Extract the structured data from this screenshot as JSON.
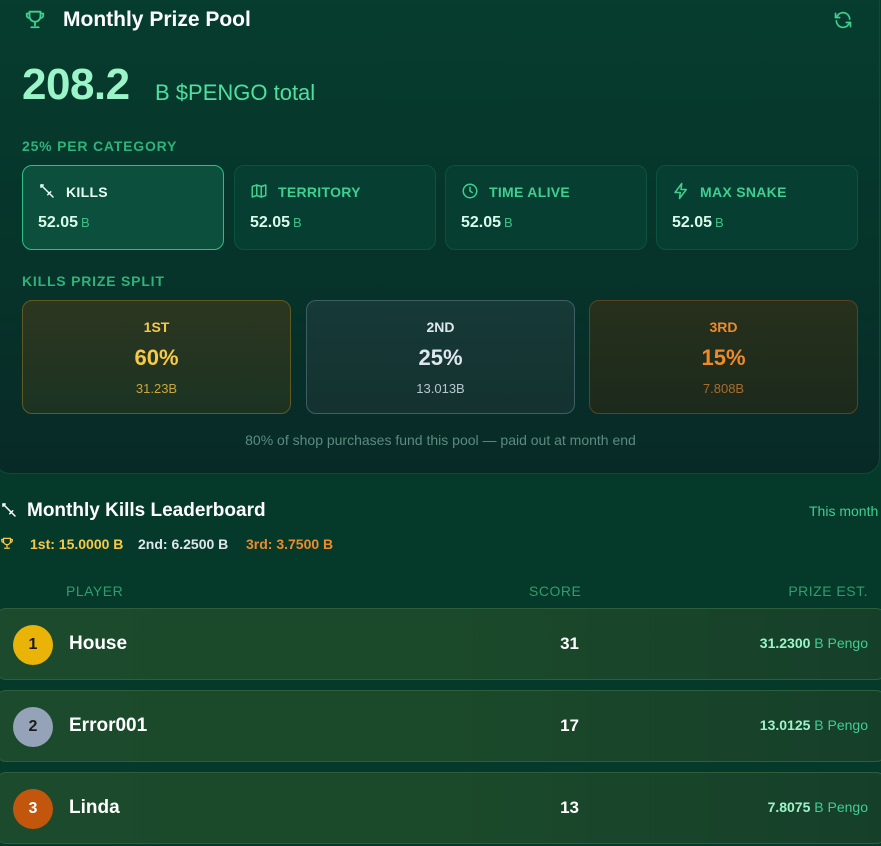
{
  "header": {
    "title": "Monthly Prize Pool",
    "icon": "trophy-icon",
    "refresh_icon": "refresh-icon"
  },
  "pool": {
    "amount": "208.2",
    "unit": "B $PENGO total"
  },
  "categories_label": "25% PER CATEGORY",
  "categories": [
    {
      "name": "KILLS",
      "icon": "sword-icon",
      "value": "52.05",
      "unit": "B",
      "active": true
    },
    {
      "name": "TERRITORY",
      "icon": "map-icon",
      "value": "52.05",
      "unit": "B",
      "active": false
    },
    {
      "name": "TIME ALIVE",
      "icon": "clock-icon",
      "value": "52.05",
      "unit": "B",
      "active": false
    },
    {
      "name": "MAX SNAKE",
      "icon": "lightning-icon",
      "value": "52.05",
      "unit": "B",
      "active": false
    }
  ],
  "split_label": "KILLS PRIZE SPLIT",
  "split": [
    {
      "rank": "1ST",
      "pct": "60%",
      "amount": "31.23B",
      "color": "#f7c948"
    },
    {
      "rank": "2ND",
      "pct": "25%",
      "amount": "13.013B",
      "color": "#dfe7ee"
    },
    {
      "rank": "3RD",
      "pct": "15%",
      "amount": "7.808B",
      "color": "#ef8a2a"
    }
  ],
  "footnote": "80% of shop purchases fund this pool — paid out at month end",
  "leaderboard": {
    "title": "Monthly Kills Leaderboard",
    "period": "This month",
    "prize_split": [
      {
        "text": "1st: 15.0000 B",
        "color": "#f7c948"
      },
      {
        "text": "2nd: 6.2500 B",
        "color": "#dfe7ee"
      },
      {
        "text": "3rd: 3.7500 B",
        "color": "#ef8a2a"
      }
    ],
    "columns": {
      "player": "PLAYER",
      "score": "SCORE",
      "prize": "PRIZE EST."
    },
    "rows": [
      {
        "rank": "1",
        "name": "House",
        "score": "31",
        "prize": "31.2300",
        "prize_unit": "B Pengo",
        "badge_color": "#eab308"
      },
      {
        "rank": "2",
        "name": "Error001",
        "score": "17",
        "prize": "13.0125",
        "prize_unit": "B Pengo",
        "badge_color": "#94a3b8"
      },
      {
        "rank": "3",
        "name": "Linda",
        "score": "13",
        "prize": "7.8075",
        "prize_unit": "B Pengo",
        "badge_color": "#c2560c"
      }
    ]
  }
}
